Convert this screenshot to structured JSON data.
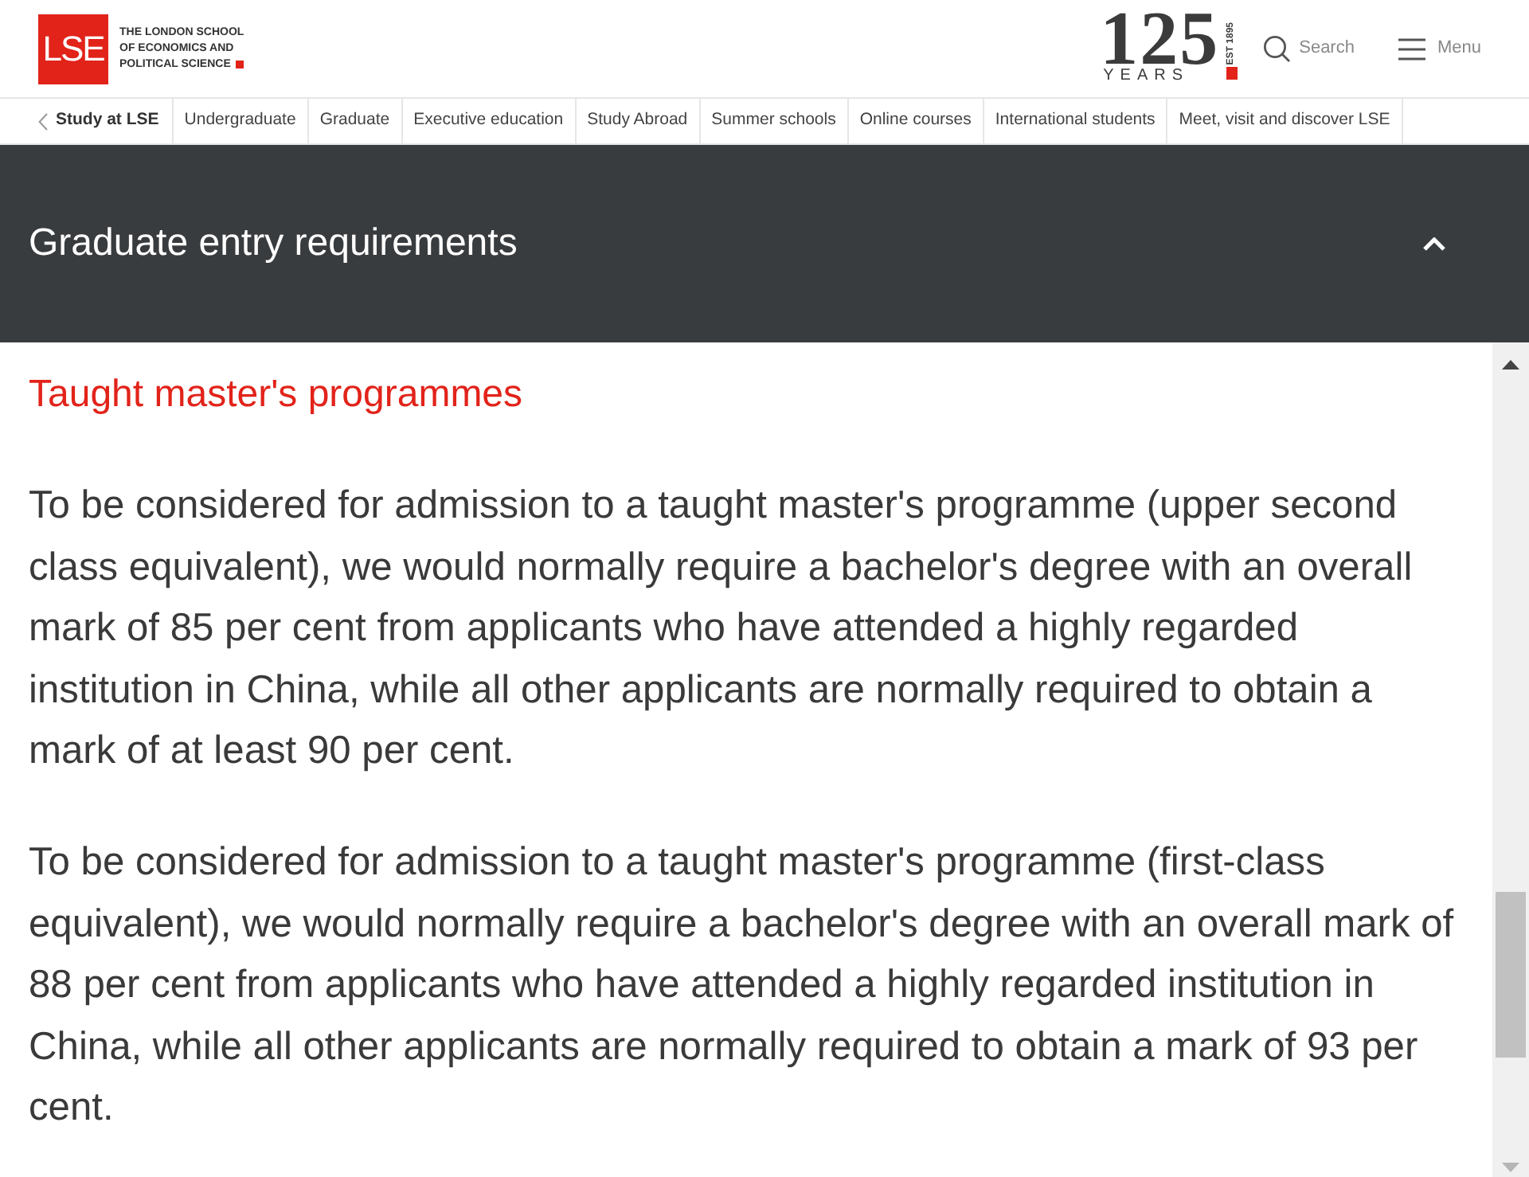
{
  "header": {
    "logo": {
      "mark": "LSE",
      "name_lines": [
        "THE LONDON SCHOOL",
        "OF ECONOMICS AND",
        "POLITICAL SCIENCE"
      ]
    },
    "anniversary_logo": {
      "number": "125",
      "word": "YEARS",
      "established": "EST 1895"
    },
    "search": "Search",
    "menu": "Menu"
  },
  "nav": {
    "back_label": "Study at LSE",
    "items": [
      "Undergraduate",
      "Graduate",
      "Executive education",
      "Study Abroad",
      "Summer schools",
      "Online courses",
      "International students",
      "Meet, visit and discover LSE"
    ]
  },
  "accordion": {
    "title": "Graduate entry requirements",
    "expanded": true
  },
  "content": {
    "heading": "Taught master's programmes",
    "paragraphs": [
      "To be considered for admission to a taught master's programme (upper second class equivalent), we would normally require a bachelor's degree with an overall mark of 85 per cent from applicants who have attended a highly regarded institution in China, while all other applicants are normally required to obtain a mark of at least 90 per cent.",
      "To be considered for admission to a taught master's programme (first-class equivalent), we would normally require a bachelor's degree with an overall mark of 88 per cent from applicants who have attended a highly regarded institution in China, while all other applicants are normally required to obtain a mark of 93 per cent."
    ]
  }
}
